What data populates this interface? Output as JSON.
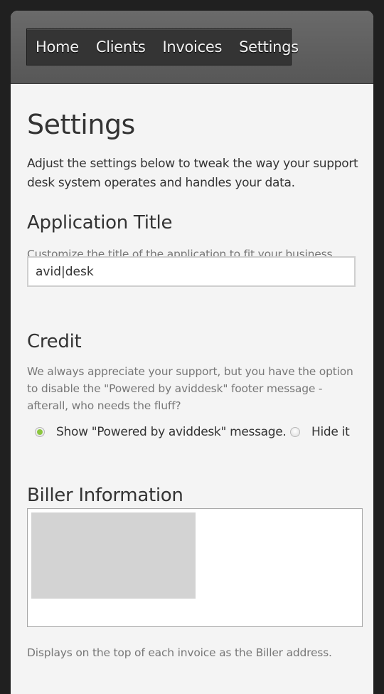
{
  "nav": {
    "items": [
      {
        "label": "Home"
      },
      {
        "label": "Clients"
      },
      {
        "label": "Invoices"
      },
      {
        "label": "Settings"
      }
    ]
  },
  "page": {
    "title": "Settings",
    "intro": "Adjust the settings below to tweak the way your support desk system operates and handles your data."
  },
  "app_title": {
    "heading": "Application Title",
    "description": "Customize the title of the application to fit your business.",
    "value": "avid|desk"
  },
  "credit": {
    "heading": "Credit",
    "description": "We always appreciate your support, but you have the option to disable the \"Powered by aviddesk\" footer message - afterall, who needs the fluff?",
    "options": [
      {
        "label": "Show \"Powered by aviddesk\" message.",
        "selected": true
      },
      {
        "label": "Hide it",
        "selected": false
      }
    ]
  },
  "biller": {
    "heading": "Biller Information",
    "description": "Displays on the top of each invoice as the Biller address."
  },
  "colors": {
    "accent": "#8cc63f",
    "page_background": "#f4f4f4",
    "header": "#5f5f5f",
    "nav_background": "#343434"
  }
}
